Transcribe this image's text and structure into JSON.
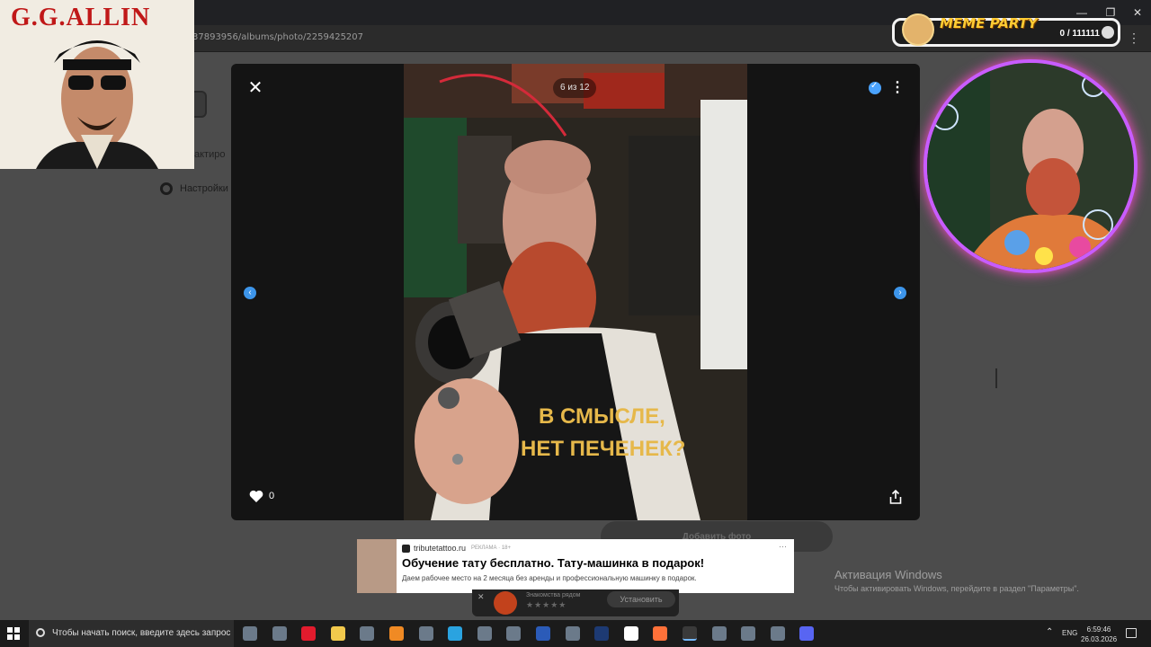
{
  "browser": {
    "url": "37893956/albums/photo/2259425207"
  },
  "page": {
    "edit_label": "актиро",
    "settings_label": "Настройки",
    "add_photo_label": "Добавить фото"
  },
  "viewer": {
    "counter": "6 из 12",
    "likes": "0",
    "apron_line1": "В СМЫСЛЕ,",
    "apron_line2": "НЕТ ПЕЧЕНЕК?"
  },
  "overlay_left": {
    "title": "G.G.ALLIN"
  },
  "meme_widget": {
    "title": "MEME PARTY",
    "count": "0 / 111111"
  },
  "ad": {
    "site": "tributetattoo.ru",
    "label": "РЕКЛАМА · 18+",
    "title": "Обучение тату бесплатно. Тату-машинка в подарок!",
    "text": "Даем рабочее место на 2 месяца без аренды и профессиональную машинку в подарок.",
    "more": "···"
  },
  "notification": {
    "text": "Знакомства рядом",
    "stars": "★★★★★",
    "button": "Установить"
  },
  "watermark": {
    "title": "Активация Windows",
    "subtitle": "Чтобы активировать Windows, перейдите в раздел \"Параметры\"."
  },
  "taskbar": {
    "search_placeholder": "Чтобы начать поиск, введите здесь запрос",
    "lang": "ENG",
    "time": "6:59:46",
    "date": "26.03.2026",
    "apps": [
      "task-view",
      "explorer-window",
      "opera",
      "file-explorer",
      "mahjong",
      "vlc",
      "zip",
      "telegram",
      "opera-gx",
      "terminal",
      "word",
      "notepad",
      "photoshop",
      "yandex",
      "firefox",
      "chrome",
      "obs",
      "audio-app",
      "chrome-2",
      "discord"
    ],
    "colors": {
      "opera": "#e21b2d",
      "file-explorer": "#f2c94c",
      "vlc": "#f08a24",
      "telegram": "#2aa3e0",
      "word": "#2b5bb8",
      "photoshop": "#1d3a73",
      "yandex": "#ffffff",
      "firefox": "#ff7139",
      "chrome": "#4caf50",
      "discord": "#5865f2"
    }
  }
}
